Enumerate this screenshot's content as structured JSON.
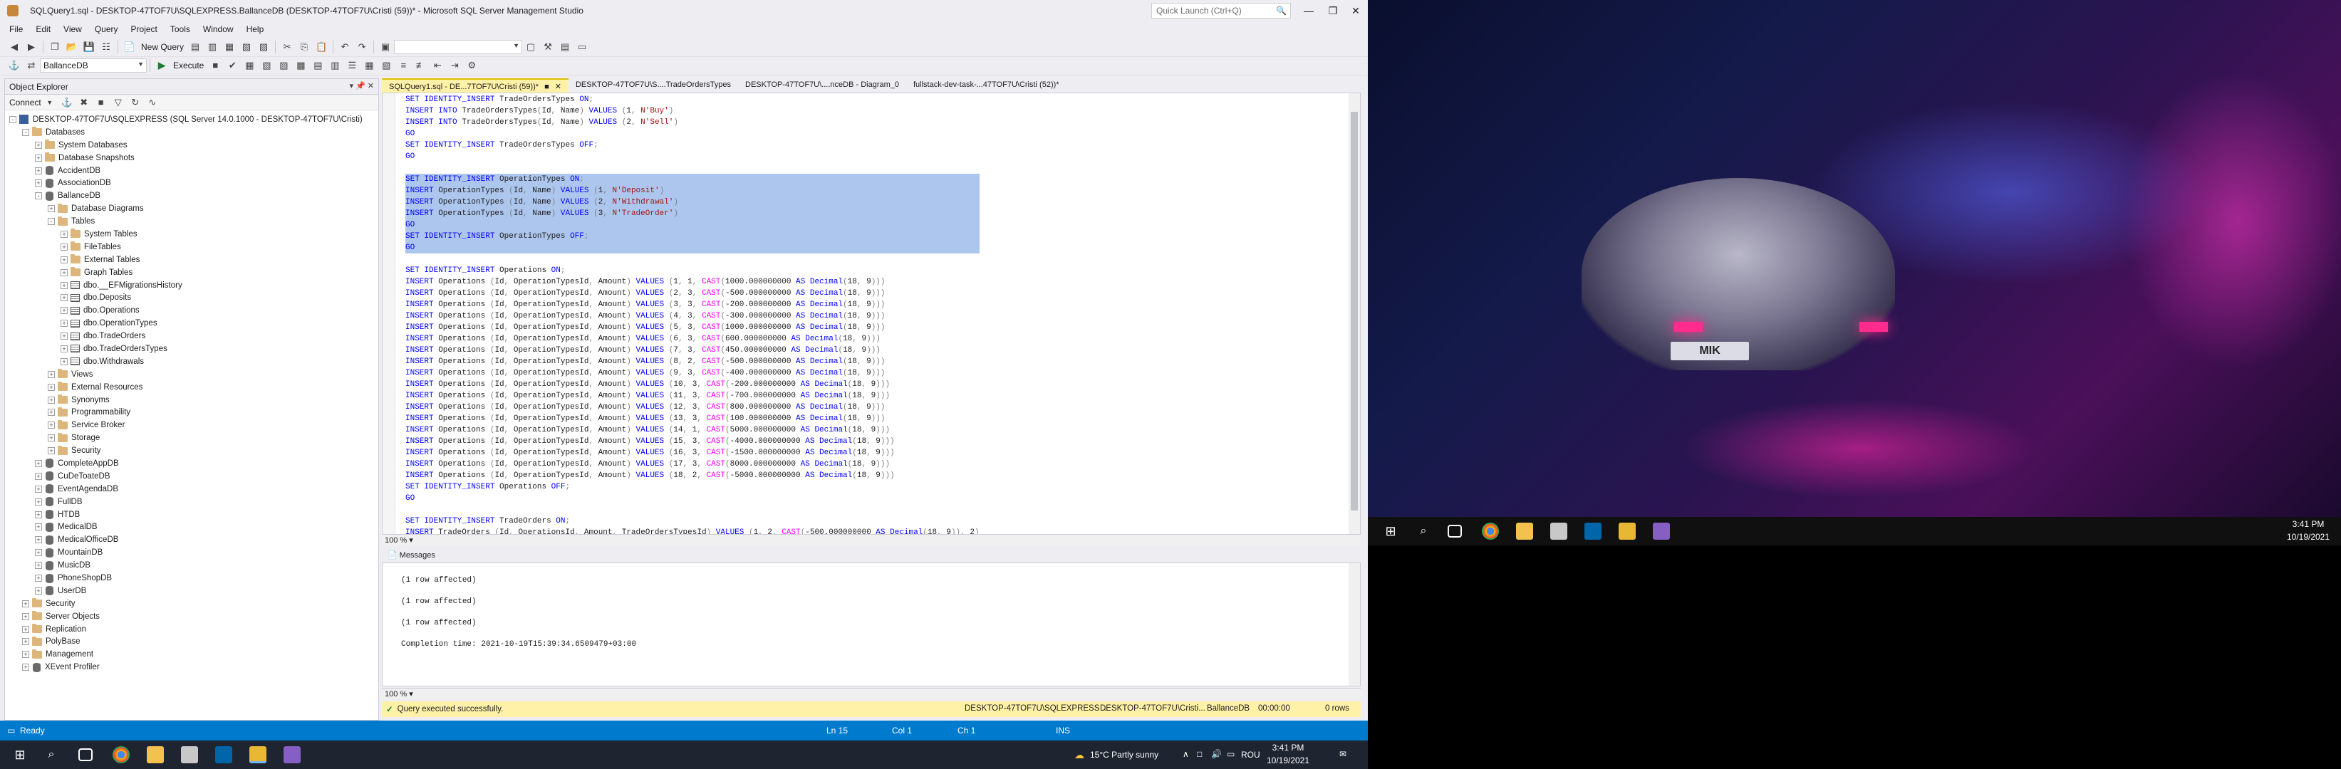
{
  "window": {
    "title": "SQLQuery1.sql - DESKTOP-47TOF7U\\SQLEXPRESS.BallanceDB (DESKTOP-47TOF7U\\Cristi (59))* - Microsoft SQL Server Management Studio",
    "quick_launch_placeholder": "Quick Launch (Ctrl+Q)",
    "min": "—",
    "max": "❐",
    "close": "✕"
  },
  "menu": [
    "File",
    "Edit",
    "View",
    "Query",
    "Project",
    "Tools",
    "Window",
    "Help"
  ],
  "toolbar": {
    "new_query": "New Query",
    "database_selected": "BallanceDB",
    "execute": "Execute"
  },
  "object_explorer": {
    "title": "Object Explorer",
    "connect": "Connect",
    "nodes": [
      {
        "label": "DESKTOP-47TOF7U\\SQLEXPRESS (SQL Server 14.0.1000 - DESKTOP-47TOF7U\\Cristi)",
        "depth": 0,
        "icon": "server",
        "exp": "-"
      },
      {
        "label": "Databases",
        "depth": 1,
        "icon": "folder",
        "exp": "-"
      },
      {
        "label": "System Databases",
        "depth": 2,
        "icon": "folder",
        "exp": "+"
      },
      {
        "label": "Database Snapshots",
        "depth": 2,
        "icon": "folder",
        "exp": "+"
      },
      {
        "label": "AccidentDB",
        "depth": 2,
        "icon": "db",
        "exp": "+"
      },
      {
        "label": "AssociationDB",
        "depth": 2,
        "icon": "db",
        "exp": "+"
      },
      {
        "label": "BallanceDB",
        "depth": 2,
        "icon": "db",
        "exp": "-"
      },
      {
        "label": "Database Diagrams",
        "depth": 3,
        "icon": "folder",
        "exp": "+"
      },
      {
        "label": "Tables",
        "depth": 3,
        "icon": "folder",
        "exp": "-"
      },
      {
        "label": "System Tables",
        "depth": 4,
        "icon": "folder",
        "exp": "+"
      },
      {
        "label": "FileTables",
        "depth": 4,
        "icon": "folder",
        "exp": "+"
      },
      {
        "label": "External Tables",
        "depth": 4,
        "icon": "folder",
        "exp": "+"
      },
      {
        "label": "Graph Tables",
        "depth": 4,
        "icon": "folder",
        "exp": "+"
      },
      {
        "label": "dbo.__EFMigrationsHistory",
        "depth": 4,
        "icon": "table",
        "exp": "+"
      },
      {
        "label": "dbo.Deposits",
        "depth": 4,
        "icon": "table",
        "exp": "+"
      },
      {
        "label": "dbo.Operations",
        "depth": 4,
        "icon": "table",
        "exp": "+"
      },
      {
        "label": "dbo.OperationTypes",
        "depth": 4,
        "icon": "table",
        "exp": "+"
      },
      {
        "label": "dbo.TradeOrders",
        "depth": 4,
        "icon": "table",
        "exp": "+"
      },
      {
        "label": "dbo.TradeOrdersTypes",
        "depth": 4,
        "icon": "table",
        "exp": "+"
      },
      {
        "label": "dbo.Withdrawals",
        "depth": 4,
        "icon": "table",
        "exp": "+"
      },
      {
        "label": "Views",
        "depth": 3,
        "icon": "folder",
        "exp": "+"
      },
      {
        "label": "External Resources",
        "depth": 3,
        "icon": "folder",
        "exp": "+"
      },
      {
        "label": "Synonyms",
        "depth": 3,
        "icon": "folder",
        "exp": "+"
      },
      {
        "label": "Programmability",
        "depth": 3,
        "icon": "folder",
        "exp": "+"
      },
      {
        "label": "Service Broker",
        "depth": 3,
        "icon": "folder",
        "exp": "+"
      },
      {
        "label": "Storage",
        "depth": 3,
        "icon": "folder",
        "exp": "+"
      },
      {
        "label": "Security",
        "depth": 3,
        "icon": "folder",
        "exp": "+"
      },
      {
        "label": "CompleteAppDB",
        "depth": 2,
        "icon": "db",
        "exp": "+"
      },
      {
        "label": "CuDeToateDB",
        "depth": 2,
        "icon": "db",
        "exp": "+"
      },
      {
        "label": "EventAgendaDB",
        "depth": 2,
        "icon": "db",
        "exp": "+"
      },
      {
        "label": "FullDB",
        "depth": 2,
        "icon": "db",
        "exp": "+"
      },
      {
        "label": "HTDB",
        "depth": 2,
        "icon": "db",
        "exp": "+"
      },
      {
        "label": "MedicalDB",
        "depth": 2,
        "icon": "db",
        "exp": "+"
      },
      {
        "label": "MedicalOfficeDB",
        "depth": 2,
        "icon": "db",
        "exp": "+"
      },
      {
        "label": "MountainDB",
        "depth": 2,
        "icon": "db",
        "exp": "+"
      },
      {
        "label": "MusicDB",
        "depth": 2,
        "icon": "db",
        "exp": "+"
      },
      {
        "label": "PhoneShopDB",
        "depth": 2,
        "icon": "db",
        "exp": "+"
      },
      {
        "label": "UserDB",
        "depth": 2,
        "icon": "db",
        "exp": "+"
      },
      {
        "label": "Security",
        "depth": 1,
        "icon": "folder",
        "exp": "+"
      },
      {
        "label": "Server Objects",
        "depth": 1,
        "icon": "folder",
        "exp": "+"
      },
      {
        "label": "Replication",
        "depth": 1,
        "icon": "folder",
        "exp": "+"
      },
      {
        "label": "PolyBase",
        "depth": 1,
        "icon": "folder",
        "exp": "+"
      },
      {
        "label": "Management",
        "depth": 1,
        "icon": "folder",
        "exp": "+"
      },
      {
        "label": "XEvent Profiler",
        "depth": 1,
        "icon": "xevent",
        "exp": "+"
      }
    ]
  },
  "tabs": [
    {
      "label": "SQLQuery1.sql - DE...7TOF7U\\Cristi (59))*",
      "active": true
    },
    {
      "label": "DESKTOP-47TOF7U\\S....TradeOrdersTypes",
      "active": false
    },
    {
      "label": "DESKTOP-47TOF7U\\....nceDB - Diagram_0",
      "active": false
    },
    {
      "label": "fullstack-dev-task-...47TOF7U\\Cristi (52))*",
      "active": false
    }
  ],
  "code_lines": [
    {
      "sel": false,
      "t": "SET IDENTITY_INSERT TradeOrdersTypes ON;"
    },
    {
      "sel": false,
      "t": "INSERT INTO TradeOrdersTypes(Id, Name) VALUES (1, N'Buy')"
    },
    {
      "sel": false,
      "t": "INSERT INTO TradeOrdersTypes(Id, Name) VALUES (2, N'Sell')"
    },
    {
      "sel": false,
      "t": "GO"
    },
    {
      "sel": false,
      "t": "SET IDENTITY_INSERT TradeOrdersTypes OFF;"
    },
    {
      "sel": false,
      "t": "GO"
    },
    {
      "sel": false,
      "t": ""
    },
    {
      "sel": true,
      "t": "SET IDENTITY_INSERT OperationTypes ON;"
    },
    {
      "sel": true,
      "t": "INSERT OperationTypes (Id, Name) VALUES (1, N'Deposit')"
    },
    {
      "sel": true,
      "t": "INSERT OperationTypes (Id, Name) VALUES (2, N'Withdrawal')"
    },
    {
      "sel": true,
      "t": "INSERT OperationTypes (Id, Name) VALUES (3, N'TradeOrder')"
    },
    {
      "sel": true,
      "t": "GO"
    },
    {
      "sel": true,
      "t": "SET IDENTITY_INSERT OperationTypes OFF;"
    },
    {
      "sel": true,
      "t": "GO"
    },
    {
      "sel": false,
      "t": ""
    },
    {
      "sel": false,
      "t": "SET IDENTITY_INSERT Operations ON;"
    },
    {
      "sel": false,
      "t": "INSERT Operations (Id, OperationTypesId, Amount) VALUES (1, 1, CAST(1000.000000000 AS Decimal(18, 9)))"
    },
    {
      "sel": false,
      "t": "INSERT Operations (Id, OperationTypesId, Amount) VALUES (2, 3, CAST(-500.000000000 AS Decimal(18, 9)))"
    },
    {
      "sel": false,
      "t": "INSERT Operations (Id, OperationTypesId, Amount) VALUES (3, 3, CAST(-200.000000000 AS Decimal(18, 9)))"
    },
    {
      "sel": false,
      "t": "INSERT Operations (Id, OperationTypesId, Amount) VALUES (4, 3, CAST(-300.000000000 AS Decimal(18, 9)))"
    },
    {
      "sel": false,
      "t": "INSERT Operations (Id, OperationTypesId, Amount) VALUES (5, 3, CAST(1000.000000000 AS Decimal(18, 9)))"
    },
    {
      "sel": false,
      "t": "INSERT Operations (Id, OperationTypesId, Amount) VALUES (6, 3, CAST(600.000000000 AS Decimal(18, 9)))"
    },
    {
      "sel": false,
      "t": "INSERT Operations (Id, OperationTypesId, Amount) VALUES (7, 3, CAST(450.000000000 AS Decimal(18, 9)))"
    },
    {
      "sel": false,
      "t": "INSERT Operations (Id, OperationTypesId, Amount) VALUES (8, 2, CAST(-500.000000000 AS Decimal(18, 9)))"
    },
    {
      "sel": false,
      "t": "INSERT Operations (Id, OperationTypesId, Amount) VALUES (9, 3, CAST(-400.000000000 AS Decimal(18, 9)))"
    },
    {
      "sel": false,
      "t": "INSERT Operations (Id, OperationTypesId, Amount) VALUES (10, 3, CAST(-200.000000000 AS Decimal(18, 9)))"
    },
    {
      "sel": false,
      "t": "INSERT Operations (Id, OperationTypesId, Amount) VALUES (11, 3, CAST(-700.000000000 AS Decimal(18, 9)))"
    },
    {
      "sel": false,
      "t": "INSERT Operations (Id, OperationTypesId, Amount) VALUES (12, 3, CAST(800.000000000 AS Decimal(18, 9)))"
    },
    {
      "sel": false,
      "t": "INSERT Operations (Id, OperationTypesId, Amount) VALUES (13, 3, CAST(100.000000000 AS Decimal(18, 9)))"
    },
    {
      "sel": false,
      "t": "INSERT Operations (Id, OperationTypesId, Amount) VALUES (14, 1, CAST(5000.000000000 AS Decimal(18, 9)))"
    },
    {
      "sel": false,
      "t": "INSERT Operations (Id, OperationTypesId, Amount) VALUES (15, 3, CAST(-4000.000000000 AS Decimal(18, 9)))"
    },
    {
      "sel": false,
      "t": "INSERT Operations (Id, OperationTypesId, Amount) VALUES (16, 3, CAST(-1500.000000000 AS Decimal(18, 9)))"
    },
    {
      "sel": false,
      "t": "INSERT Operations (Id, OperationTypesId, Amount) VALUES (17, 3, CAST(8000.000000000 AS Decimal(18, 9)))"
    },
    {
      "sel": false,
      "t": "INSERT Operations (Id, OperationTypesId, Amount) VALUES (18, 2, CAST(-5000.000000000 AS Decimal(18, 9)))"
    },
    {
      "sel": false,
      "t": "SET IDENTITY_INSERT Operations OFF;"
    },
    {
      "sel": false,
      "t": "GO"
    },
    {
      "sel": false,
      "t": ""
    },
    {
      "sel": false,
      "t": "SET IDENTITY_INSERT TradeOrders ON;"
    },
    {
      "sel": false,
      "t": "INSERT TradeOrders (Id, OperationsId, Amount, TradeOrdersTypesId) VALUES (1, 2, CAST(-500.000000000 AS Decimal(18, 9)), 2)"
    }
  ],
  "editor_zoom": "100 %",
  "messages": {
    "tab": "Messages",
    "lines": [
      "(1 row affected)",
      "(1 row affected)",
      "(1 row affected)",
      "Completion time: 2021-10-19T15:39:34.6509479+03:00"
    ],
    "zoom": "100 %"
  },
  "query_status": {
    "ok": "✓",
    "text": "Query executed successfully.",
    "server": "DESKTOP-47TOF7U\\SQLEXPRESS ...",
    "user": "DESKTOP-47TOF7U\\Cristi...",
    "db": "BallanceDB",
    "time": "00:00:00",
    "rows": "0 rows"
  },
  "statusbar": {
    "ready": "Ready",
    "ln": "Ln 15",
    "col": "Col 1",
    "ch": "Ch 1",
    "ins": "INS"
  },
  "taskbar_left": {
    "weather": "15°C  Partly sunny",
    "lang": "ROU",
    "time": "3:41 PM",
    "date": "10/19/2021"
  },
  "wallpaper": {
    "plate": "MIK"
  },
  "taskbar_right": {
    "time": "3:41 PM",
    "date": "10/19/2021"
  },
  "colors": {
    "accent": "#007acc",
    "tab_active": "#fff1a8",
    "selection": "#adc6ee",
    "keyword": "#0000ff",
    "string": "#a31515",
    "function": "#ff00ff"
  }
}
